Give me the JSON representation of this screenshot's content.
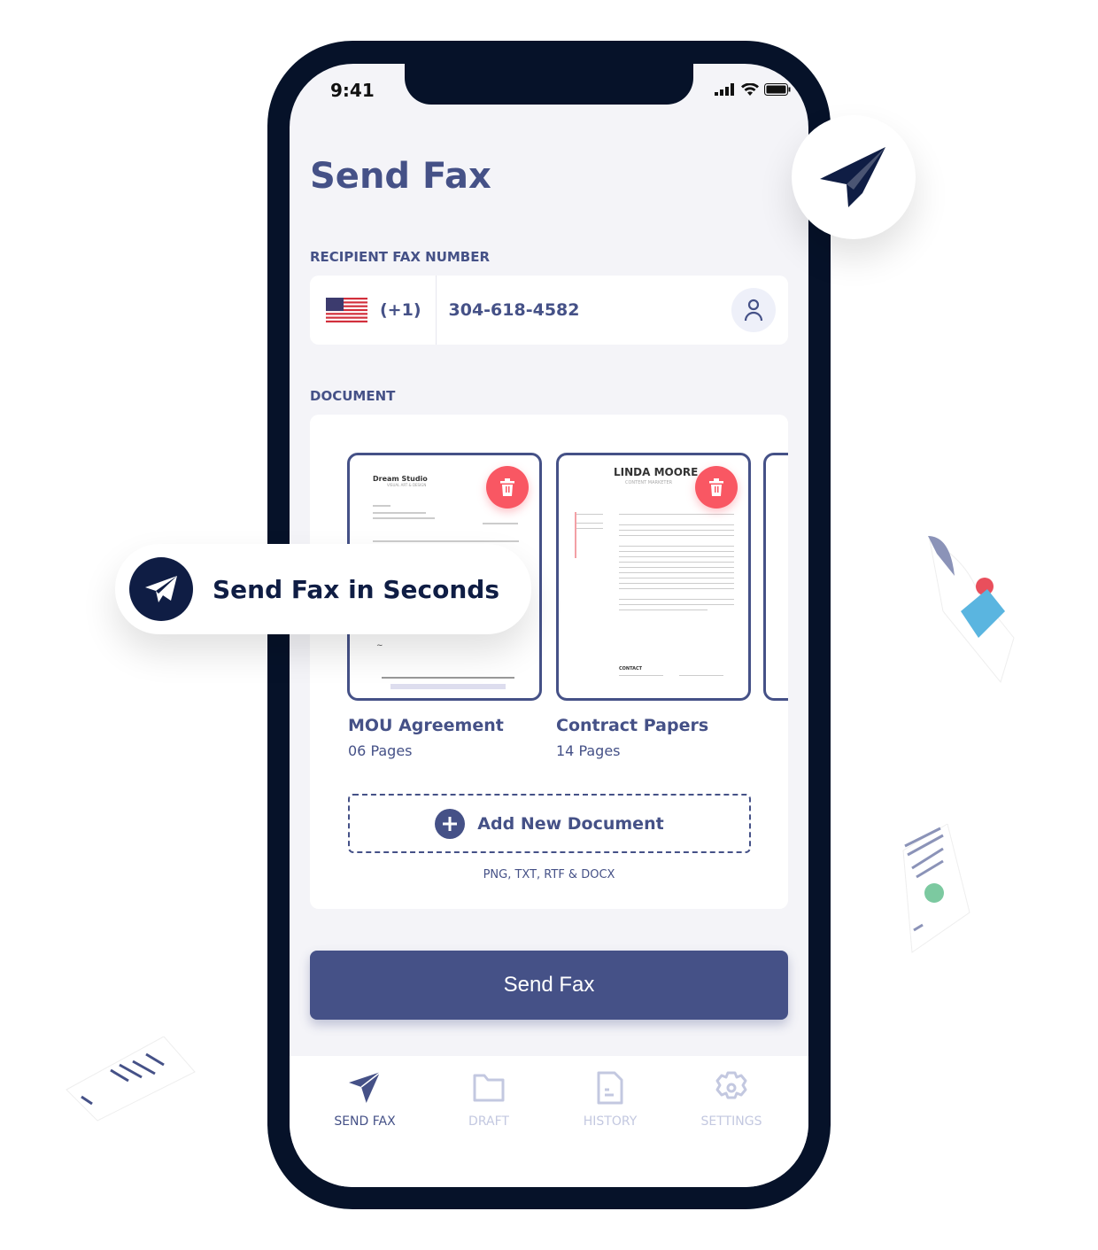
{
  "status_bar": {
    "time": "9:41"
  },
  "page": {
    "title": "Send Fax"
  },
  "recipient": {
    "label": "RECIPIENT FAX NUMBER",
    "country_code": "(+1)",
    "number": "304-618-4582",
    "flag": "us-flag",
    "contact_icon": "person-icon"
  },
  "document": {
    "label": "DOCUMENT",
    "items": [
      {
        "name": "MOU Agreement",
        "pages": "06 Pages",
        "brand": "Dream Studio",
        "brand_sub": "VISUAL ART & DESIGN"
      },
      {
        "name": "Contract Papers",
        "pages": "14 Pages",
        "heading": "LINDA MOORE",
        "subheading": "CONTENT MARKETER",
        "contact": "CONTACT"
      }
    ],
    "add_label": "Add New Document",
    "formats": "PNG, TXT, RTF & DOCX"
  },
  "send_button": "Send Fax",
  "nav": [
    {
      "label": "SEND FAX",
      "icon": "paper-plane-icon",
      "active": true
    },
    {
      "label": "DRAFT",
      "icon": "folder-icon",
      "active": false
    },
    {
      "label": "HISTORY",
      "icon": "document-icon",
      "active": false
    },
    {
      "label": "SETTINGS",
      "icon": "gear-icon",
      "active": false
    }
  ],
  "callout": {
    "text": "Send Fax in Seconds"
  },
  "colors": {
    "primary": "#455187",
    "dark": "#061229",
    "danger": "#f95763",
    "inactive": "#c3c8e0"
  }
}
